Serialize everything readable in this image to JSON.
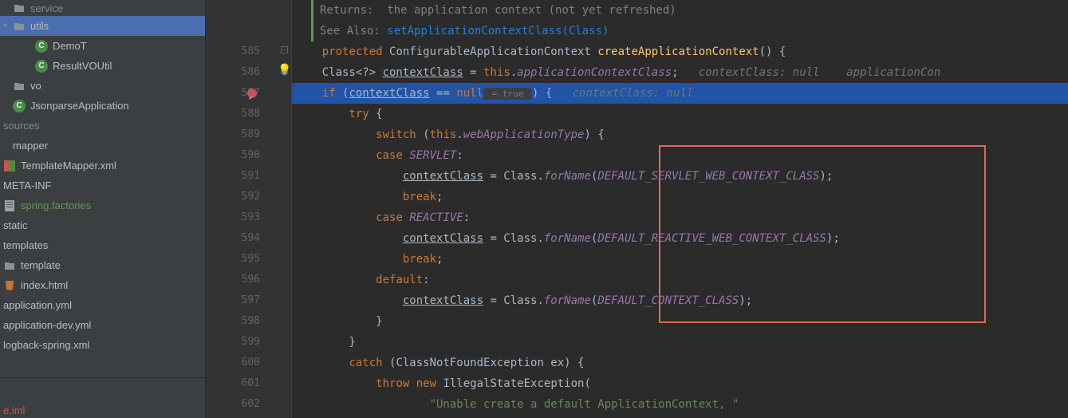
{
  "sidebar": {
    "items": [
      {
        "label": "service",
        "type": "folder",
        "indent": 0,
        "dim": true
      },
      {
        "label": "utils",
        "type": "folder",
        "indent": 0,
        "expanded": true,
        "selected": true
      },
      {
        "label": "DemoT",
        "type": "class",
        "indent": 2
      },
      {
        "label": "ResultVOUtil",
        "type": "class",
        "indent": 2
      },
      {
        "label": "vo",
        "type": "folder",
        "indent": 0
      },
      {
        "label": "JsonparseApplication",
        "type": "class",
        "indent": 0
      },
      {
        "label": "sources",
        "type": "folder-plain",
        "indent": 0,
        "dim": true
      },
      {
        "label": "mapper",
        "type": "none",
        "indent": 0
      },
      {
        "label": "TemplateMapper.xml",
        "type": "xml-orange",
        "indent": 0
      },
      {
        "label": "META-INF",
        "type": "none",
        "indent": 0
      },
      {
        "label": "spring.factories",
        "type": "file-green",
        "indent": 0,
        "green": true
      },
      {
        "label": "static",
        "type": "none",
        "indent": 0
      },
      {
        "label": "templates",
        "type": "none",
        "indent": 0
      },
      {
        "label": "template",
        "type": "folder",
        "indent": 0
      },
      {
        "label": "index.html",
        "type": "html",
        "indent": 0
      },
      {
        "label": "application.yml",
        "type": "none",
        "indent": 0
      },
      {
        "label": "application-dev.yml",
        "type": "none",
        "indent": 0
      },
      {
        "label": "logback-spring.xml",
        "type": "none",
        "indent": 0
      }
    ],
    "iml": "e.iml"
  },
  "gutter": {
    "start": 585,
    "count": 19,
    "preLines": 2,
    "breakpoint": 587
  },
  "doc": {
    "returns": "Returns:  the application context (not yet refreshed)",
    "seeAlso": "See Also: ",
    "seeAlsoLink": "setApplicationContextClass(Class)"
  },
  "code": {
    "l585": {
      "protected": "protected ",
      "type": "ConfigurableApplicationContext ",
      "method": "createApplicationContext",
      "paren": "() {"
    },
    "l586": {
      "pre": "    Class<?> ",
      "var": "contextClass",
      "eq": " = ",
      "this": "this",
      "dot": ".",
      "field": "applicationContextClass",
      "semi": ";",
      "hint1": "   contextClass: null",
      "hint2": "    applicationCon"
    },
    "l587": {
      "pre": "    ",
      "if": "if ",
      "open": "(",
      "var": "contextClass",
      "eq": " == ",
      "null": "null",
      "hintTrue": " = true ",
      "close": ") {",
      "hint": "   contextClass: null"
    },
    "l588": {
      "pre": "        ",
      "try": "try ",
      "brace": "{"
    },
    "l589": {
      "pre": "            ",
      "switch": "switch ",
      "open": "(",
      "this": "this",
      "dot": ".",
      "field": "webApplicationType",
      "close": ") {"
    },
    "l590": {
      "pre": "            ",
      "case": "case ",
      "const": "SERVLET",
      "colon": ":"
    },
    "l591": {
      "pre": "                ",
      "var": "contextClass",
      "eq": " = Class.",
      "forName": "forName",
      "open": "(",
      "const": "DEFAULT_SERVLET_WEB_CONTEXT_CLASS",
      "close": ");"
    },
    "l592": {
      "pre": "                ",
      "break": "break",
      "semi": ";"
    },
    "l593": {
      "pre": "            ",
      "case": "case ",
      "const": "REACTIVE",
      "colon": ":"
    },
    "l594": {
      "pre": "                ",
      "var": "contextClass",
      "eq": " = Class.",
      "forName": "forName",
      "open": "(",
      "const": "DEFAULT_REACTIVE_WEB_CONTEXT_CLASS",
      "close": ");"
    },
    "l595": {
      "pre": "                ",
      "break": "break",
      "semi": ";"
    },
    "l596": {
      "pre": "            ",
      "default": "default",
      "colon": ":"
    },
    "l597": {
      "pre": "                ",
      "var": "contextClass",
      "eq": " = Class.",
      "forName": "forName",
      "open": "(",
      "const": "DEFAULT_CONTEXT_CLASS",
      "close": ");"
    },
    "l598": {
      "pre": "            }",
      "text": ""
    },
    "l599": {
      "pre": "        }",
      "text": ""
    },
    "l600": {
      "pre": "        ",
      "catch": "catch ",
      "open": "(ClassNotFoundException ex) {"
    },
    "l601": {
      "pre": "            ",
      "throw": "throw ",
      "new": "new ",
      "type": "IllegalStateException("
    },
    "l602": {
      "pre": "                    ",
      "str": "\"Unable create a default ApplicationContext, \""
    }
  }
}
